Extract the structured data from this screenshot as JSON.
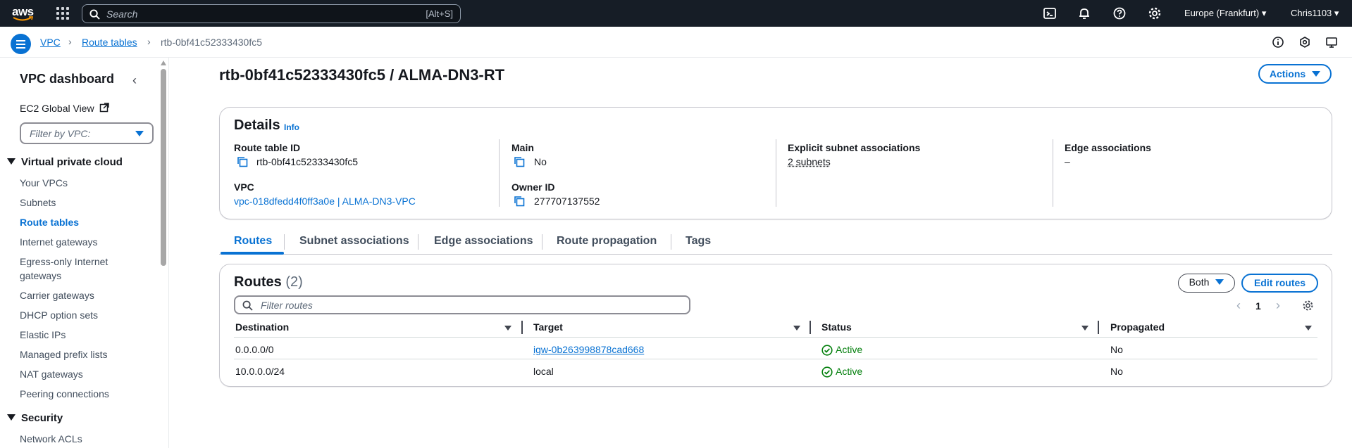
{
  "topnav": {
    "logo": "aws",
    "search_placeholder": "Search",
    "search_shortcut": "[Alt+S]",
    "icons": [
      "cloudshell-icon",
      "bell-icon",
      "help-icon",
      "gear-icon"
    ],
    "region": "Europe (Frankfurt) ▾",
    "user": "Chris1103 ▾"
  },
  "breadcrumb": {
    "items": [
      "VPC",
      "Route tables",
      "rtb-0bf41c52333430fc5"
    ]
  },
  "sidebar": {
    "title": "VPC dashboard",
    "ec2_global_view": "EC2 Global View",
    "filter_placeholder": "Filter by VPC:",
    "sections": [
      {
        "title": "Virtual private cloud",
        "items": [
          "Your VPCs",
          "Subnets",
          "Route tables",
          "Internet gateways",
          "Egress-only Internet",
          "gateways",
          "Carrier gateways",
          "DHCP option sets",
          "Elastic IPs",
          "Managed prefix lists",
          "NAT gateways",
          "Peering connections"
        ]
      },
      {
        "title": "Security",
        "items": [
          "Network ACLs"
        ]
      }
    ],
    "active_item": "Route tables"
  },
  "page": {
    "title": "rtb-0bf41c52333430fc5 / ALMA-DN3-RT",
    "actions_label": "Actions"
  },
  "details": {
    "title": "Details",
    "info": "Info",
    "route_table_id_label": "Route table ID",
    "route_table_id": "rtb-0bf41c52333430fc5",
    "vpc_label": "VPC",
    "vpc": "vpc-018dfedd4f0ff3a0e | ALMA-DN3-VPC",
    "main_label": "Main",
    "main": "No",
    "owner_label": "Owner ID",
    "owner": "277707137552",
    "explicit_label": "Explicit subnet associations",
    "explicit": "2 subnets",
    "edge_label": "Edge associations",
    "edge": "–"
  },
  "tabs": [
    "Routes",
    "Subnet associations",
    "Edge associations",
    "Route propagation",
    "Tags"
  ],
  "active_tab": "Routes",
  "routes": {
    "title": "Routes",
    "count": "(2)",
    "filter_select": "Both",
    "edit_label": "Edit routes",
    "filter_placeholder": "Filter routes",
    "page": "1",
    "columns": [
      "Destination",
      "Target",
      "Status",
      "Propagated"
    ],
    "rows": [
      {
        "destination": "0.0.0.0/0",
        "target": "igw-0b263998878cad668",
        "status": "Active",
        "propagated": "No"
      },
      {
        "destination": "10.0.0.0/24",
        "target": "local",
        "status": "Active",
        "propagated": "No"
      }
    ]
  },
  "colors": {
    "nav_bg": "#161d26",
    "accent": "#0972d3",
    "success": "#037f0c"
  }
}
